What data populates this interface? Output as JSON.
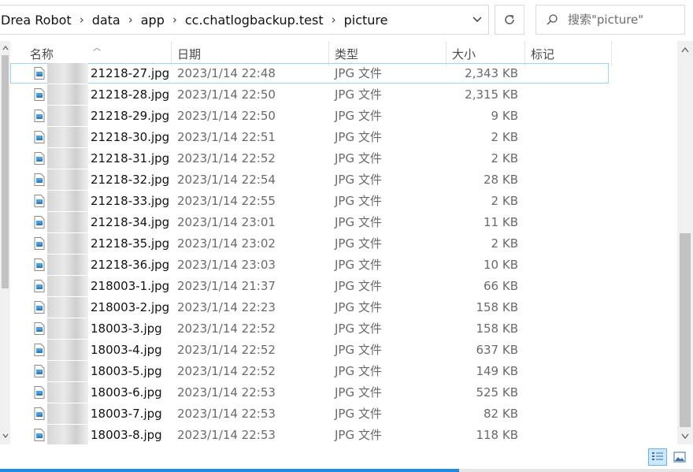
{
  "address": {
    "crumbs": [
      "Drea Robot",
      "data",
      "app",
      "cc.chatlogbackup.test",
      "picture"
    ]
  },
  "search": {
    "placeholder": "搜索\"picture\""
  },
  "columns": {
    "name": "名称",
    "date": "日期",
    "type": "类型",
    "size": "大小",
    "tags": "标记"
  },
  "files": [
    {
      "name": "21218-27.jpg",
      "date": "2023/1/14 22:48",
      "type": "JPG 文件",
      "size": "2,343 KB"
    },
    {
      "name": "21218-28.jpg",
      "date": "2023/1/14 22:50",
      "type": "JPG 文件",
      "size": "2,315 KB"
    },
    {
      "name": "21218-29.jpg",
      "date": "2023/1/14 22:50",
      "type": "JPG 文件",
      "size": "9 KB"
    },
    {
      "name": "21218-30.jpg",
      "date": "2023/1/14 22:51",
      "type": "JPG 文件",
      "size": "2 KB"
    },
    {
      "name": "21218-31.jpg",
      "date": "2023/1/14 22:52",
      "type": "JPG 文件",
      "size": "2 KB"
    },
    {
      "name": "21218-32.jpg",
      "date": "2023/1/14 22:54",
      "type": "JPG 文件",
      "size": "28 KB"
    },
    {
      "name": "21218-33.jpg",
      "date": "2023/1/14 22:55",
      "type": "JPG 文件",
      "size": "2 KB"
    },
    {
      "name": "21218-34.jpg",
      "date": "2023/1/14 23:01",
      "type": "JPG 文件",
      "size": "11 KB"
    },
    {
      "name": "21218-35.jpg",
      "date": "2023/1/14 23:02",
      "type": "JPG 文件",
      "size": "2 KB"
    },
    {
      "name": "21218-36.jpg",
      "date": "2023/1/14 23:03",
      "type": "JPG 文件",
      "size": "10 KB"
    },
    {
      "name": "218003-1.jpg",
      "date": "2023/1/14 21:37",
      "type": "JPG 文件",
      "size": "66 KB"
    },
    {
      "name": "218003-2.jpg",
      "date": "2023/1/14 22:23",
      "type": "JPG 文件",
      "size": "158 KB"
    },
    {
      "name": "18003-3.jpg",
      "date": "2023/1/14 22:52",
      "type": "JPG 文件",
      "size": "158 KB"
    },
    {
      "name": "18003-4.jpg",
      "date": "2023/1/14 22:52",
      "type": "JPG 文件",
      "size": "637 KB"
    },
    {
      "name": "18003-5.jpg",
      "date": "2023/1/14 22:52",
      "type": "JPG 文件",
      "size": "149 KB"
    },
    {
      "name": "18003-6.jpg",
      "date": "2023/1/14 22:53",
      "type": "JPG 文件",
      "size": "525 KB"
    },
    {
      "name": "18003-7.jpg",
      "date": "2023/1/14 22:53",
      "type": "JPG 文件",
      "size": "82 KB"
    },
    {
      "name": "18003-8.jpg",
      "date": "2023/1/14 22:53",
      "type": "JPG 文件",
      "size": "118 KB"
    }
  ],
  "icons": {
    "file": "jpg-file-icon",
    "dropdown": "chevron-down-icon",
    "refresh": "refresh-icon",
    "search": "search-icon",
    "details_view": "details-view-icon",
    "tiles_view": "large-icons-view-icon"
  },
  "colors": {
    "accent": "#1e8ae0",
    "selection_outline": "#99d1ff"
  }
}
